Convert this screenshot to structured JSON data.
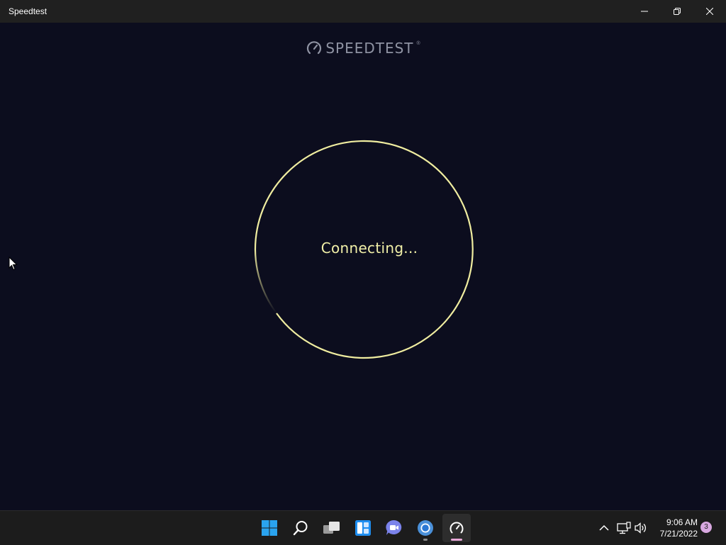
{
  "window": {
    "title": "Speedtest"
  },
  "brand": {
    "name": "SPEEDTEST",
    "trademark": "®"
  },
  "test": {
    "status_text": "Connecting..."
  },
  "taskbar": {
    "apps": [
      {
        "name": "start-icon"
      },
      {
        "name": "search-icon"
      },
      {
        "name": "task-view-icon"
      },
      {
        "name": "widgets-icon"
      },
      {
        "name": "teams-chat-icon"
      },
      {
        "name": "chrome-icon",
        "running": true
      },
      {
        "name": "speedtest-icon",
        "running": true,
        "active": true
      }
    ]
  },
  "tray": {
    "time": "9:06 AM",
    "date": "7/21/2022",
    "notification_count": "3"
  },
  "colors": {
    "background": "#0c0d1e",
    "ring": "#f0eda0",
    "status": "#f2f0a8",
    "titlebar": "#202020",
    "taskbar": "#1c1c1c"
  }
}
